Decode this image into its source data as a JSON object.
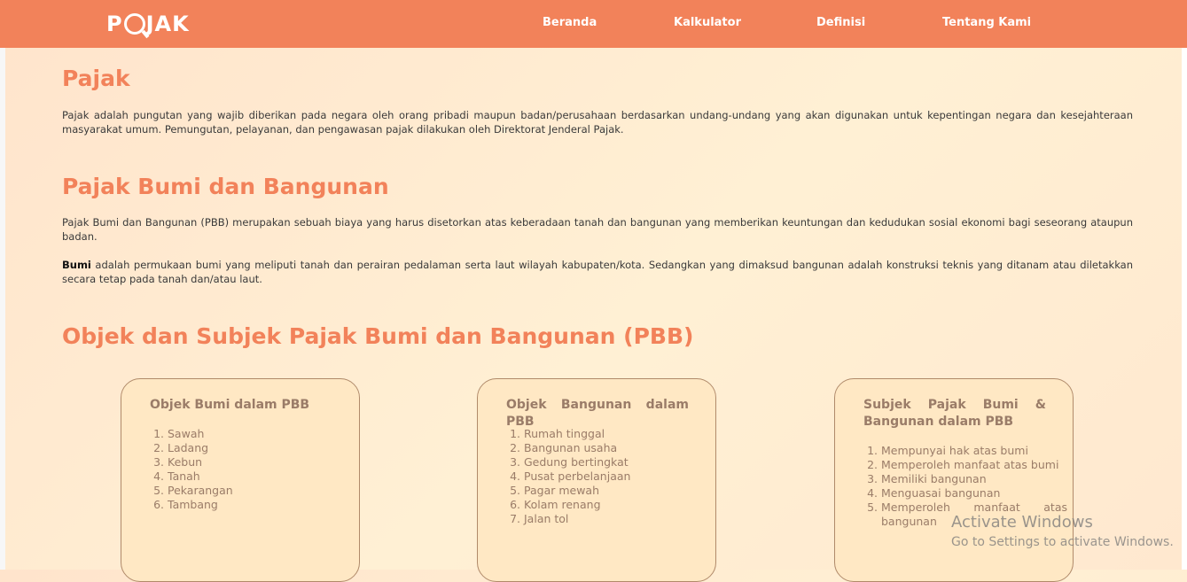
{
  "navbar": {
    "logo": {
      "pre": "P",
      "post": "JAK"
    },
    "links": [
      "Beranda",
      "Kalkulator",
      "Definisi",
      "Tentang Kami"
    ]
  },
  "sections": {
    "pajak": {
      "title": "Pajak",
      "text": "Pajak adalah pungutan yang wajib diberikan pada negara oleh orang pribadi maupun badan/perusahaan berdasarkan undang-undang yang akan digunakan untuk kepentingan negara dan kesejahteraan masyarakat umum. Pemungutan, pelayanan, dan pengawasan pajak dilakukan oleh Direktorat Jenderal Pajak."
    },
    "pbb": {
      "title": "Pajak Bumi dan Bangunan",
      "text1": "Pajak Bumi dan Bangunan (PBB) merupakan sebuah biaya yang harus disetorkan atas keberadaan tanah dan bangunan yang memberikan keuntungan dan kedudukan sosial ekonomi bagi seseorang ataupun badan.",
      "bumi_bold": "Bumi",
      "text2": " adalah permukaan bumi yang meliputi tanah dan perairan pedalaman serta laut wilayah kabupaten/kota. Sedangkan yang dimaksud bangunan adalah konstruksi teknis yang ditanam atau diletakkan secara tetap pada tanah dan/atau laut."
    },
    "objek": {
      "title": "Objek dan Subjek Pajak Bumi dan Bangunan (PBB)"
    }
  },
  "cards": [
    {
      "title": "Objek Bumi dalam PBB",
      "items": [
        "Sawah",
        "Ladang",
        "Kebun",
        "Tanah",
        "Pekarangan",
        "Tambang"
      ]
    },
    {
      "title": "Objek Bangunan dalam PBB",
      "items": [
        "Rumah tinggal",
        "Bangunan usaha",
        "Gedung bertingkat",
        "Pusat perbelanjaan",
        "Pagar mewah",
        "Kolam renang",
        "Jalan tol"
      ]
    },
    {
      "title": "Subjek Pajak Bumi & Bangunan dalam PBB",
      "items": [
        "Mempunyai hak atas bumi",
        "Memperoleh manfaat atas bumi",
        "Memiliki bangunan",
        "Menguasai bangunan",
        "Memperoleh manfaat atas bangunan"
      ]
    }
  ],
  "watermark": {
    "line1": "Activate Windows",
    "line2": "Go to Settings to activate Windows."
  },
  "colors": {
    "accent": "#f2825a",
    "card_text": "#9a7c68",
    "card_bg": "#ffe8c4"
  }
}
